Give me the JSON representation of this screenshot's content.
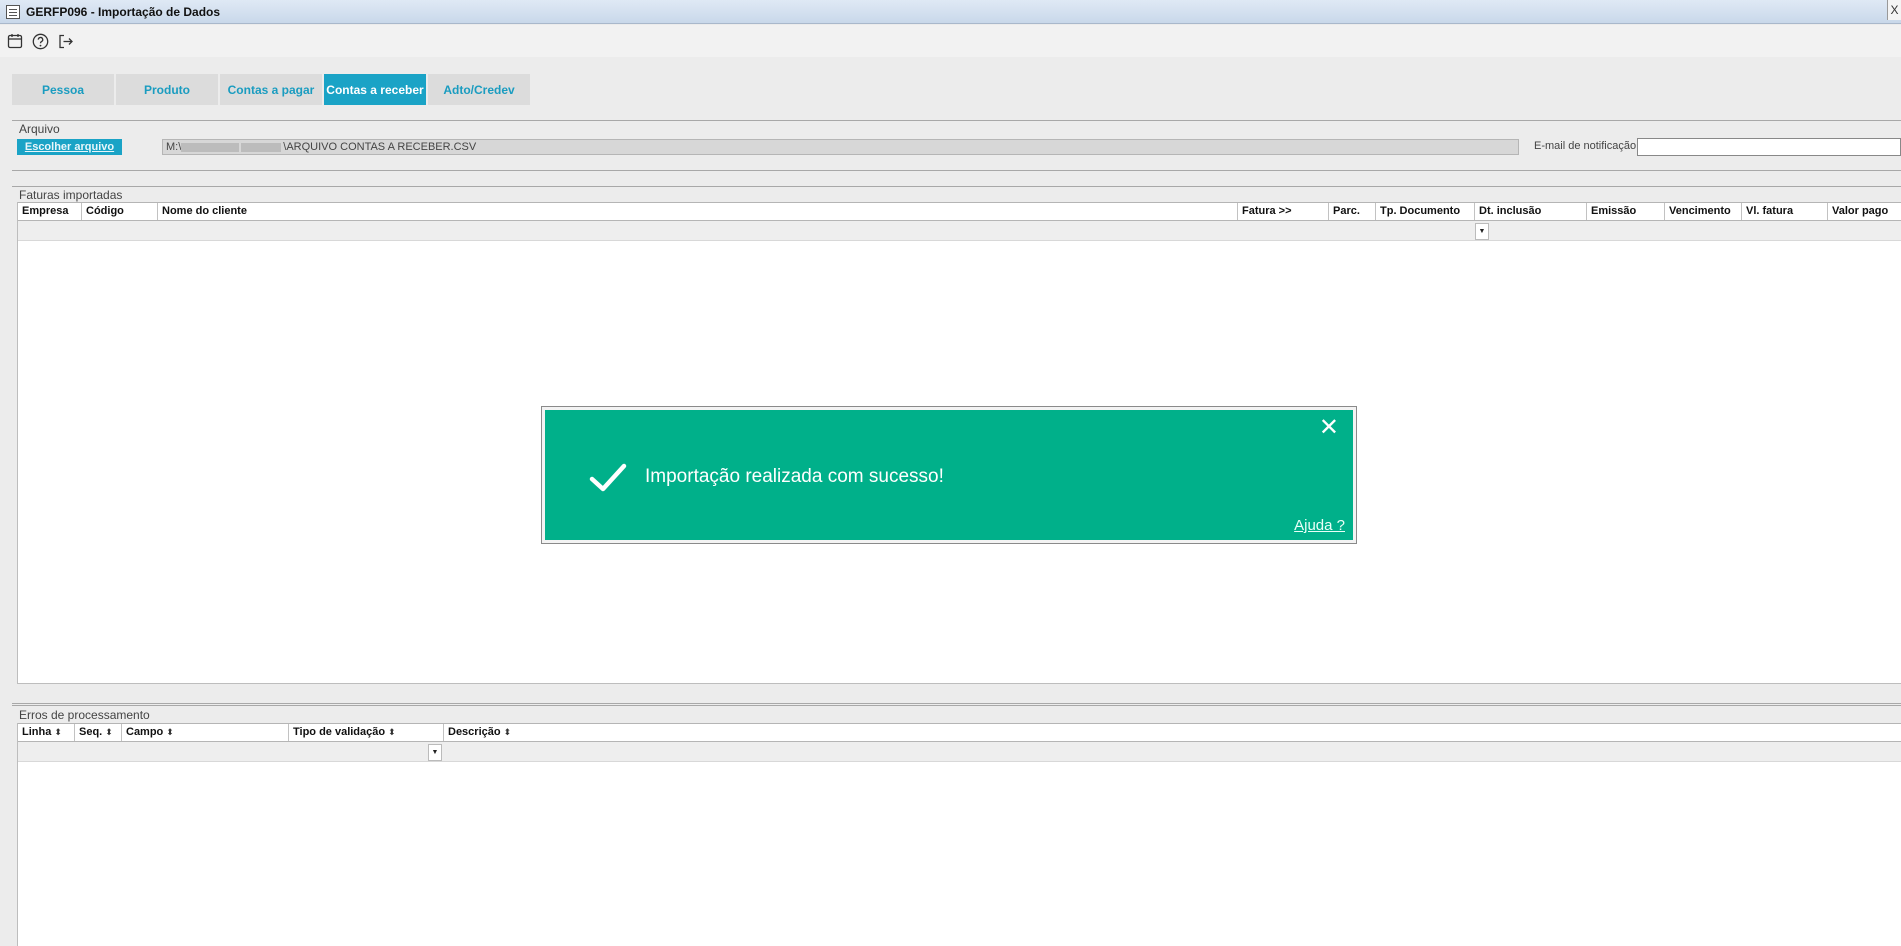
{
  "window": {
    "title": "GERFP096 - Importação de Dados",
    "close_glyph": "X"
  },
  "toolbar": {
    "icons": [
      "calendar-icon",
      "help-circle-icon",
      "exit-icon"
    ]
  },
  "tabs": [
    {
      "label": "Pessoa",
      "active": false
    },
    {
      "label": "Produto",
      "active": false
    },
    {
      "label": "Contas a pagar",
      "active": false
    },
    {
      "label": "Contas a receber",
      "active": true
    },
    {
      "label": "Adto/Credev",
      "active": false
    }
  ],
  "arquivo": {
    "section_label": "Arquivo",
    "choose_button": "Escolher arquivo",
    "file_path_prefix": "M:\\",
    "file_path": "\\ARQUIVO CONTAS A RECEBER.CSV",
    "email_label": "E-mail de notificação",
    "email_value": ""
  },
  "faturas": {
    "section_label": "Faturas importadas",
    "columns": [
      "Empresa",
      "Código",
      "Nome do cliente",
      "Fatura >>",
      "Parc.",
      "Tp. Documento",
      "Dt. inclusão",
      "Emissão",
      "Vencimento",
      "Vl. fatura",
      "Valor pago"
    ],
    "filter_dropdown_glyph": "▼"
  },
  "erros": {
    "section_label": "Erros de processamento",
    "columns": [
      "Linha",
      "Seq.",
      "Campo",
      "Tipo de validação",
      "Descrição"
    ],
    "sort_glyph": "⬍",
    "filter_dropdown_glyph": "▼"
  },
  "toast": {
    "message": "Importação realizada com sucesso!",
    "help_link": "Ajuda ?",
    "close_glyph": "✕",
    "color": "#00b08a"
  },
  "colors": {
    "accent": "#1aa3c6",
    "tab_inactive_text": "#1a9cc0"
  }
}
